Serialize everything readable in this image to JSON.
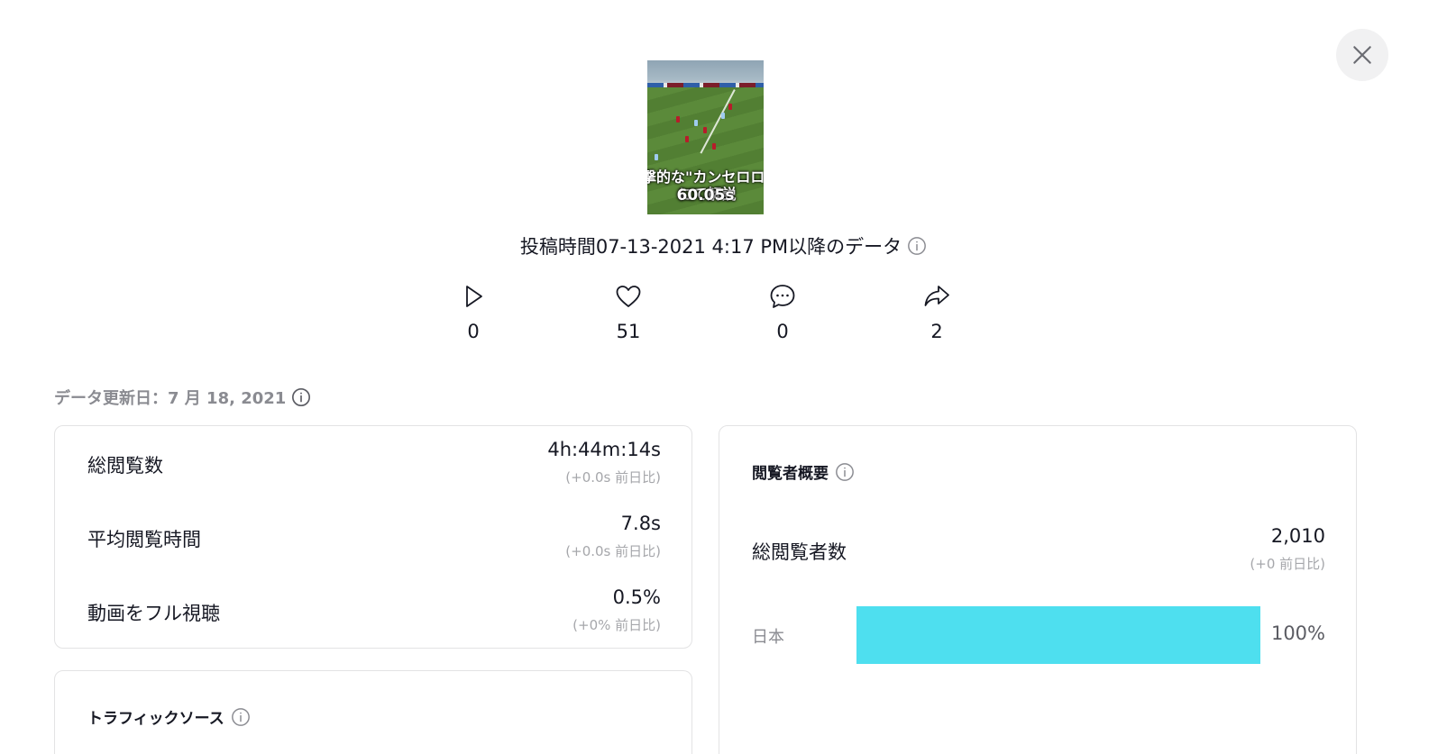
{
  "video": {
    "caption_line1": "撃的な\"カンセロロー",
    "caption_line2": "にて解説",
    "duration": "60.05s"
  },
  "posted_label": "投稿時間07-13-2021 4:17 PM以降のデータ",
  "stats": [
    {
      "icon": "play-icon",
      "value": "0"
    },
    {
      "icon": "heart-icon",
      "value": "51"
    },
    {
      "icon": "comment-icon",
      "value": "0"
    },
    {
      "icon": "share-icon",
      "value": "2"
    }
  ],
  "updated_label": "データ更新日：7 月 18, 2021",
  "metrics": [
    {
      "label": "総閲覧数",
      "value": "4h:44m:14s",
      "change": "(+0.0s 前日比)"
    },
    {
      "label": "平均閲覧時間",
      "value": "7.8s",
      "change": "(+0.0s 前日比)"
    },
    {
      "label": "動画をフル視聴",
      "value": "0.5%",
      "change": "(+0% 前日比)"
    }
  ],
  "traffic": {
    "title": "トラフィックソース"
  },
  "viewers": {
    "title": "閲覧者概要",
    "total_label": "総閲覧者数",
    "total_value": "2,010",
    "total_change": "(+0 前日比)",
    "countries": [
      {
        "name": "日本",
        "percent_label": "100%",
        "fraction": 1.0
      }
    ],
    "bar_color": "#4edfef"
  }
}
